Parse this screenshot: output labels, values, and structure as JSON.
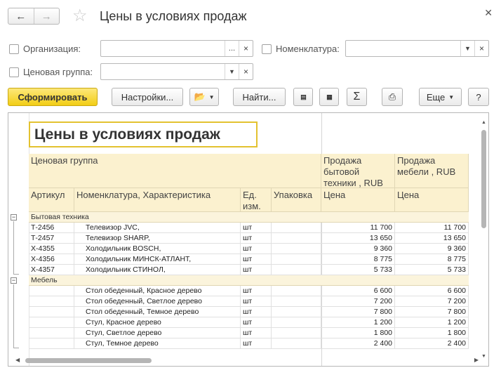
{
  "window": {
    "title": "Цены в условиях продаж"
  },
  "filters": {
    "organization_label": "Организация:",
    "nomenclature_label": "Номенклатура:",
    "price_group_label": "Ценовая группа:",
    "organization_value": "",
    "nomenclature_value": "",
    "price_group_value": "",
    "dots": "..."
  },
  "toolbar": {
    "generate": "Сформировать",
    "settings": "Настройки...",
    "find": "Найти...",
    "more": "Еще",
    "help": "?",
    "sum": "Σ"
  },
  "report": {
    "title": "Цены в условиях продаж",
    "headers": {
      "price_group": "Ценовая группа",
      "article": "Артикул",
      "nomenclature": "Номенклатура, Характеристика",
      "unit": "Ед. изм.",
      "package": "Упаковка",
      "col1_title": "Продажа бытовой техники , RUB",
      "col2_title": "Продажа мебели , RUB",
      "price1": "Цена",
      "price2": "Цена"
    },
    "groups": [
      {
        "name": "Бытовая техника",
        "rows": [
          {
            "article": "Т-2456",
            "name": "Телевизор JVC,",
            "unit": "шт",
            "price1": "11 700",
            "price2": "11 700"
          },
          {
            "article": "Т-2457",
            "name": "Телевизор SHARP,",
            "unit": "шт",
            "price1": "13 650",
            "price2": "13 650"
          },
          {
            "article": "Х-4355",
            "name": "Холодильник BOSCH,",
            "unit": "шт",
            "price1": "9 360",
            "price2": "9 360"
          },
          {
            "article": "Х-4356",
            "name": "Холодильник МИНСК-АТЛАНТ,",
            "unit": "шт",
            "price1": "8 775",
            "price2": "8 775"
          },
          {
            "article": "Х-4357",
            "name": "Холодильник СТИНОЛ,",
            "unit": "шт",
            "price1": "5 733",
            "price2": "5 733"
          }
        ]
      },
      {
        "name": "Мебель",
        "rows": [
          {
            "article": "",
            "name": "Стол обеденный, Красное дерево",
            "unit": "шт",
            "price1": "6 600",
            "price2": "6 600"
          },
          {
            "article": "",
            "name": "Стол обеденный, Светлое дерево",
            "unit": "шт",
            "price1": "7 200",
            "price2": "7 200"
          },
          {
            "article": "",
            "name": "Стол обеденный, Темное дерево",
            "unit": "шт",
            "price1": "7 800",
            "price2": "7 800"
          },
          {
            "article": "",
            "name": "Стул, Красное дерево",
            "unit": "шт",
            "price1": "1 200",
            "price2": "1 200"
          },
          {
            "article": "",
            "name": "Стул, Светлое дерево",
            "unit": "шт",
            "price1": "1 800",
            "price2": "1 800"
          },
          {
            "article": "",
            "name": "Стул, Темное дерево",
            "unit": "шт",
            "price1": "2 400",
            "price2": "2 400"
          }
        ]
      }
    ]
  },
  "colors": {
    "primary_button": "#f2cd16",
    "header_bg": "#fbf1cf",
    "title_border": "#e3c230"
  }
}
